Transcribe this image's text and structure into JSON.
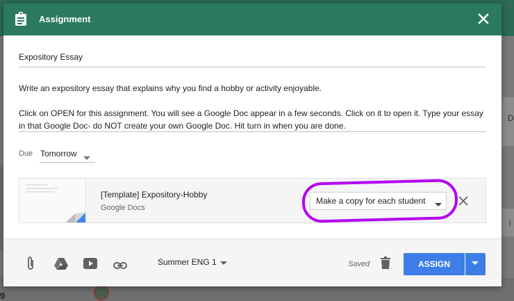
{
  "dialog": {
    "title": "Assignment",
    "assignment_title": "Expository Essay",
    "instructions": [
      "Write an expository essay that explains why you find a hobby or activity enjoyable.",
      "Click on OPEN for this assignment. You will see a Google Doc appear in a few seconds. Click on it to open it. Type your essay in that Google Doc- do NOT create your own Google Doc. Hit turn in when you are done."
    ],
    "due": {
      "label": "Due",
      "value": "Tomorrow"
    },
    "attachment": {
      "name": "[Template] Expository-Hobby",
      "type": "Google Docs",
      "sharing_option": "Make a copy for each student"
    },
    "footer": {
      "class_name": "Summer ENG 1",
      "status": "Saved",
      "assign_label": "ASSIGN"
    }
  },
  "icons": {
    "header": [
      "clipboard-icon",
      "close-icon"
    ],
    "footer": [
      "paperclip-icon",
      "google-drive-icon",
      "youtube-icon",
      "link-icon",
      "trash-icon",
      "dropdown-arrow-icon"
    ]
  },
  "colors": {
    "header": "#2b7a5e",
    "assign_button": "#3d7ee6",
    "annotation": "#b400f0"
  },
  "background": {
    "right_fragments": [
      "D",
      "l"
    ],
    "bottom_fragment": "9"
  }
}
